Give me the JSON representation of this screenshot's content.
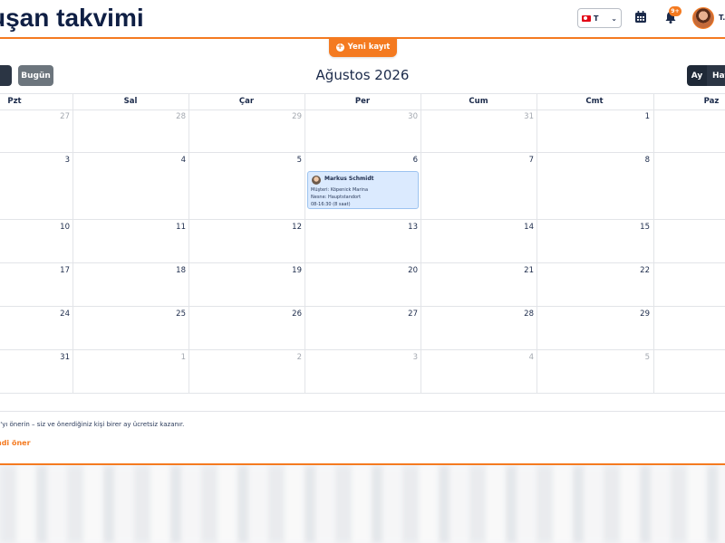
{
  "header": {
    "title": "uşan takvimi",
    "language": {
      "code": "T"
    },
    "notifications_badge": "9+",
    "user_initial": "T."
  },
  "toolbar": {
    "new_entry_label": "Yeni kayıt",
    "today_label": "Bugün",
    "month_title": "Ağustos 2026",
    "view_month_label": "Ay",
    "view_week_label": "Haf"
  },
  "calendar": {
    "weekdays": [
      "Pzt",
      "Sal",
      "Çar",
      "Per",
      "Cum",
      "Cmt",
      "Paz"
    ],
    "weeks": [
      [
        {
          "d": "27",
          "o": true
        },
        {
          "d": "28",
          "o": true
        },
        {
          "d": "29",
          "o": true
        },
        {
          "d": "30",
          "o": true
        },
        {
          "d": "31",
          "o": true
        },
        {
          "d": "1",
          "o": false
        },
        {
          "d": "",
          "o": false
        }
      ],
      [
        {
          "d": "3",
          "o": false
        },
        {
          "d": "4",
          "o": false
        },
        {
          "d": "5",
          "o": false
        },
        {
          "d": "6",
          "o": false
        },
        {
          "d": "7",
          "o": false
        },
        {
          "d": "8",
          "o": false
        },
        {
          "d": "",
          "o": false
        }
      ],
      [
        {
          "d": "10",
          "o": false
        },
        {
          "d": "11",
          "o": false
        },
        {
          "d": "12",
          "o": false
        },
        {
          "d": "13",
          "o": false
        },
        {
          "d": "14",
          "o": false
        },
        {
          "d": "15",
          "o": false
        },
        {
          "d": "",
          "o": false
        }
      ],
      [
        {
          "d": "17",
          "o": false
        },
        {
          "d": "18",
          "o": false
        },
        {
          "d": "19",
          "o": false
        },
        {
          "d": "20",
          "o": false
        },
        {
          "d": "21",
          "o": false
        },
        {
          "d": "22",
          "o": false
        },
        {
          "d": "",
          "o": false
        }
      ],
      [
        {
          "d": "24",
          "o": false
        },
        {
          "d": "25",
          "o": false
        },
        {
          "d": "26",
          "o": false
        },
        {
          "d": "27",
          "o": false
        },
        {
          "d": "28",
          "o": false
        },
        {
          "d": "29",
          "o": false
        },
        {
          "d": "",
          "o": false
        }
      ],
      [
        {
          "d": "31",
          "o": false
        },
        {
          "d": "1",
          "o": true
        },
        {
          "d": "2",
          "o": true
        },
        {
          "d": "3",
          "o": true
        },
        {
          "d": "4",
          "o": true
        },
        {
          "d": "5",
          "o": true
        },
        {
          "d": "",
          "o": false
        }
      ]
    ],
    "event": {
      "name": "Markus Schmidt",
      "customer": "Müşteri: Köpenick Marina",
      "object": "Nesne: Hauptstandort",
      "time": "08-16:30 (8 saat)"
    }
  },
  "promo": {
    "text": "a'yı önerin – siz ve önerdiğiniz kişi birer ay ücretsiz kazanır.",
    "link": "ndi öner"
  },
  "colors": {
    "accent": "#f47a20",
    "primary_text": "#1b2a4a",
    "event_bg": "#dbeafe"
  }
}
